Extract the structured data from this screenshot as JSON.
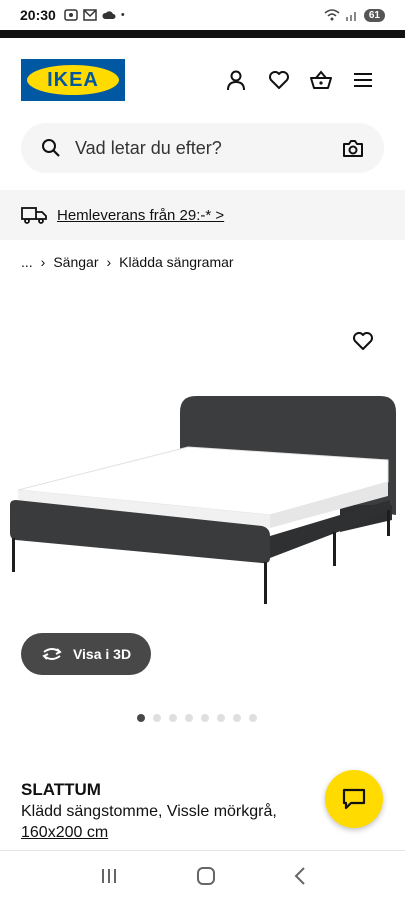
{
  "status_bar": {
    "time": "20:30",
    "battery": "61"
  },
  "header": {
    "logo_text": "IKEA"
  },
  "search": {
    "placeholder": "Vad letar du efter?"
  },
  "delivery": {
    "text": "Hemleverans från 29:-* >"
  },
  "breadcrumb": {
    "items": [
      "...",
      "Sängar",
      "Klädda sängramar"
    ],
    "separator": "›"
  },
  "product": {
    "button_3d": "Visa i 3D",
    "name": "SLATTUM",
    "description": "Klädd sängstomme, Vissle mörkgrå, ",
    "size_link": "160x200 cm"
  },
  "carousel": {
    "total": 8,
    "active": 0
  },
  "colors": {
    "ikea_blue": "#0058a3",
    "ikea_yellow": "#ffdb00",
    "dark_button": "#484848"
  }
}
